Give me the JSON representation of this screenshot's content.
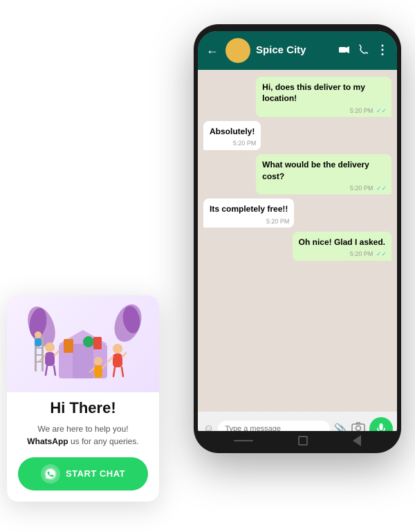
{
  "phone": {
    "header": {
      "back_label": "←",
      "contact_name": "Spice City",
      "icons": {
        "video": "📹",
        "call": "📞",
        "menu": "⋮"
      }
    },
    "messages": [
      {
        "id": "msg1",
        "type": "sent",
        "text": "Hi, does this deliver to my location!",
        "time": "5:20 PM",
        "ticks": "✓✓"
      },
      {
        "id": "msg2",
        "type": "received",
        "text": "Absolutely!",
        "time": "5:20 PM",
        "ticks": ""
      },
      {
        "id": "msg3",
        "type": "sent",
        "text": "What would be the delivery cost?",
        "time": "5:20 PM",
        "ticks": "✓✓"
      },
      {
        "id": "msg4",
        "type": "received",
        "text": "Its completely free!!",
        "time": "5:20 PM",
        "ticks": ""
      },
      {
        "id": "msg5",
        "type": "sent",
        "text": "Oh nice! Glad I asked.",
        "time": "5:20 PM",
        "ticks": "✓✓"
      }
    ],
    "input": {
      "placeholder": "Type a message"
    }
  },
  "widget": {
    "title": "Hi There!",
    "description_part1": "We are here to help you! ",
    "description_brand": "WhatsApp",
    "description_part2": " us for any queries.",
    "button_label": "START CHAT",
    "colors": {
      "green": "#25d366",
      "header_green": "#075e54"
    }
  }
}
